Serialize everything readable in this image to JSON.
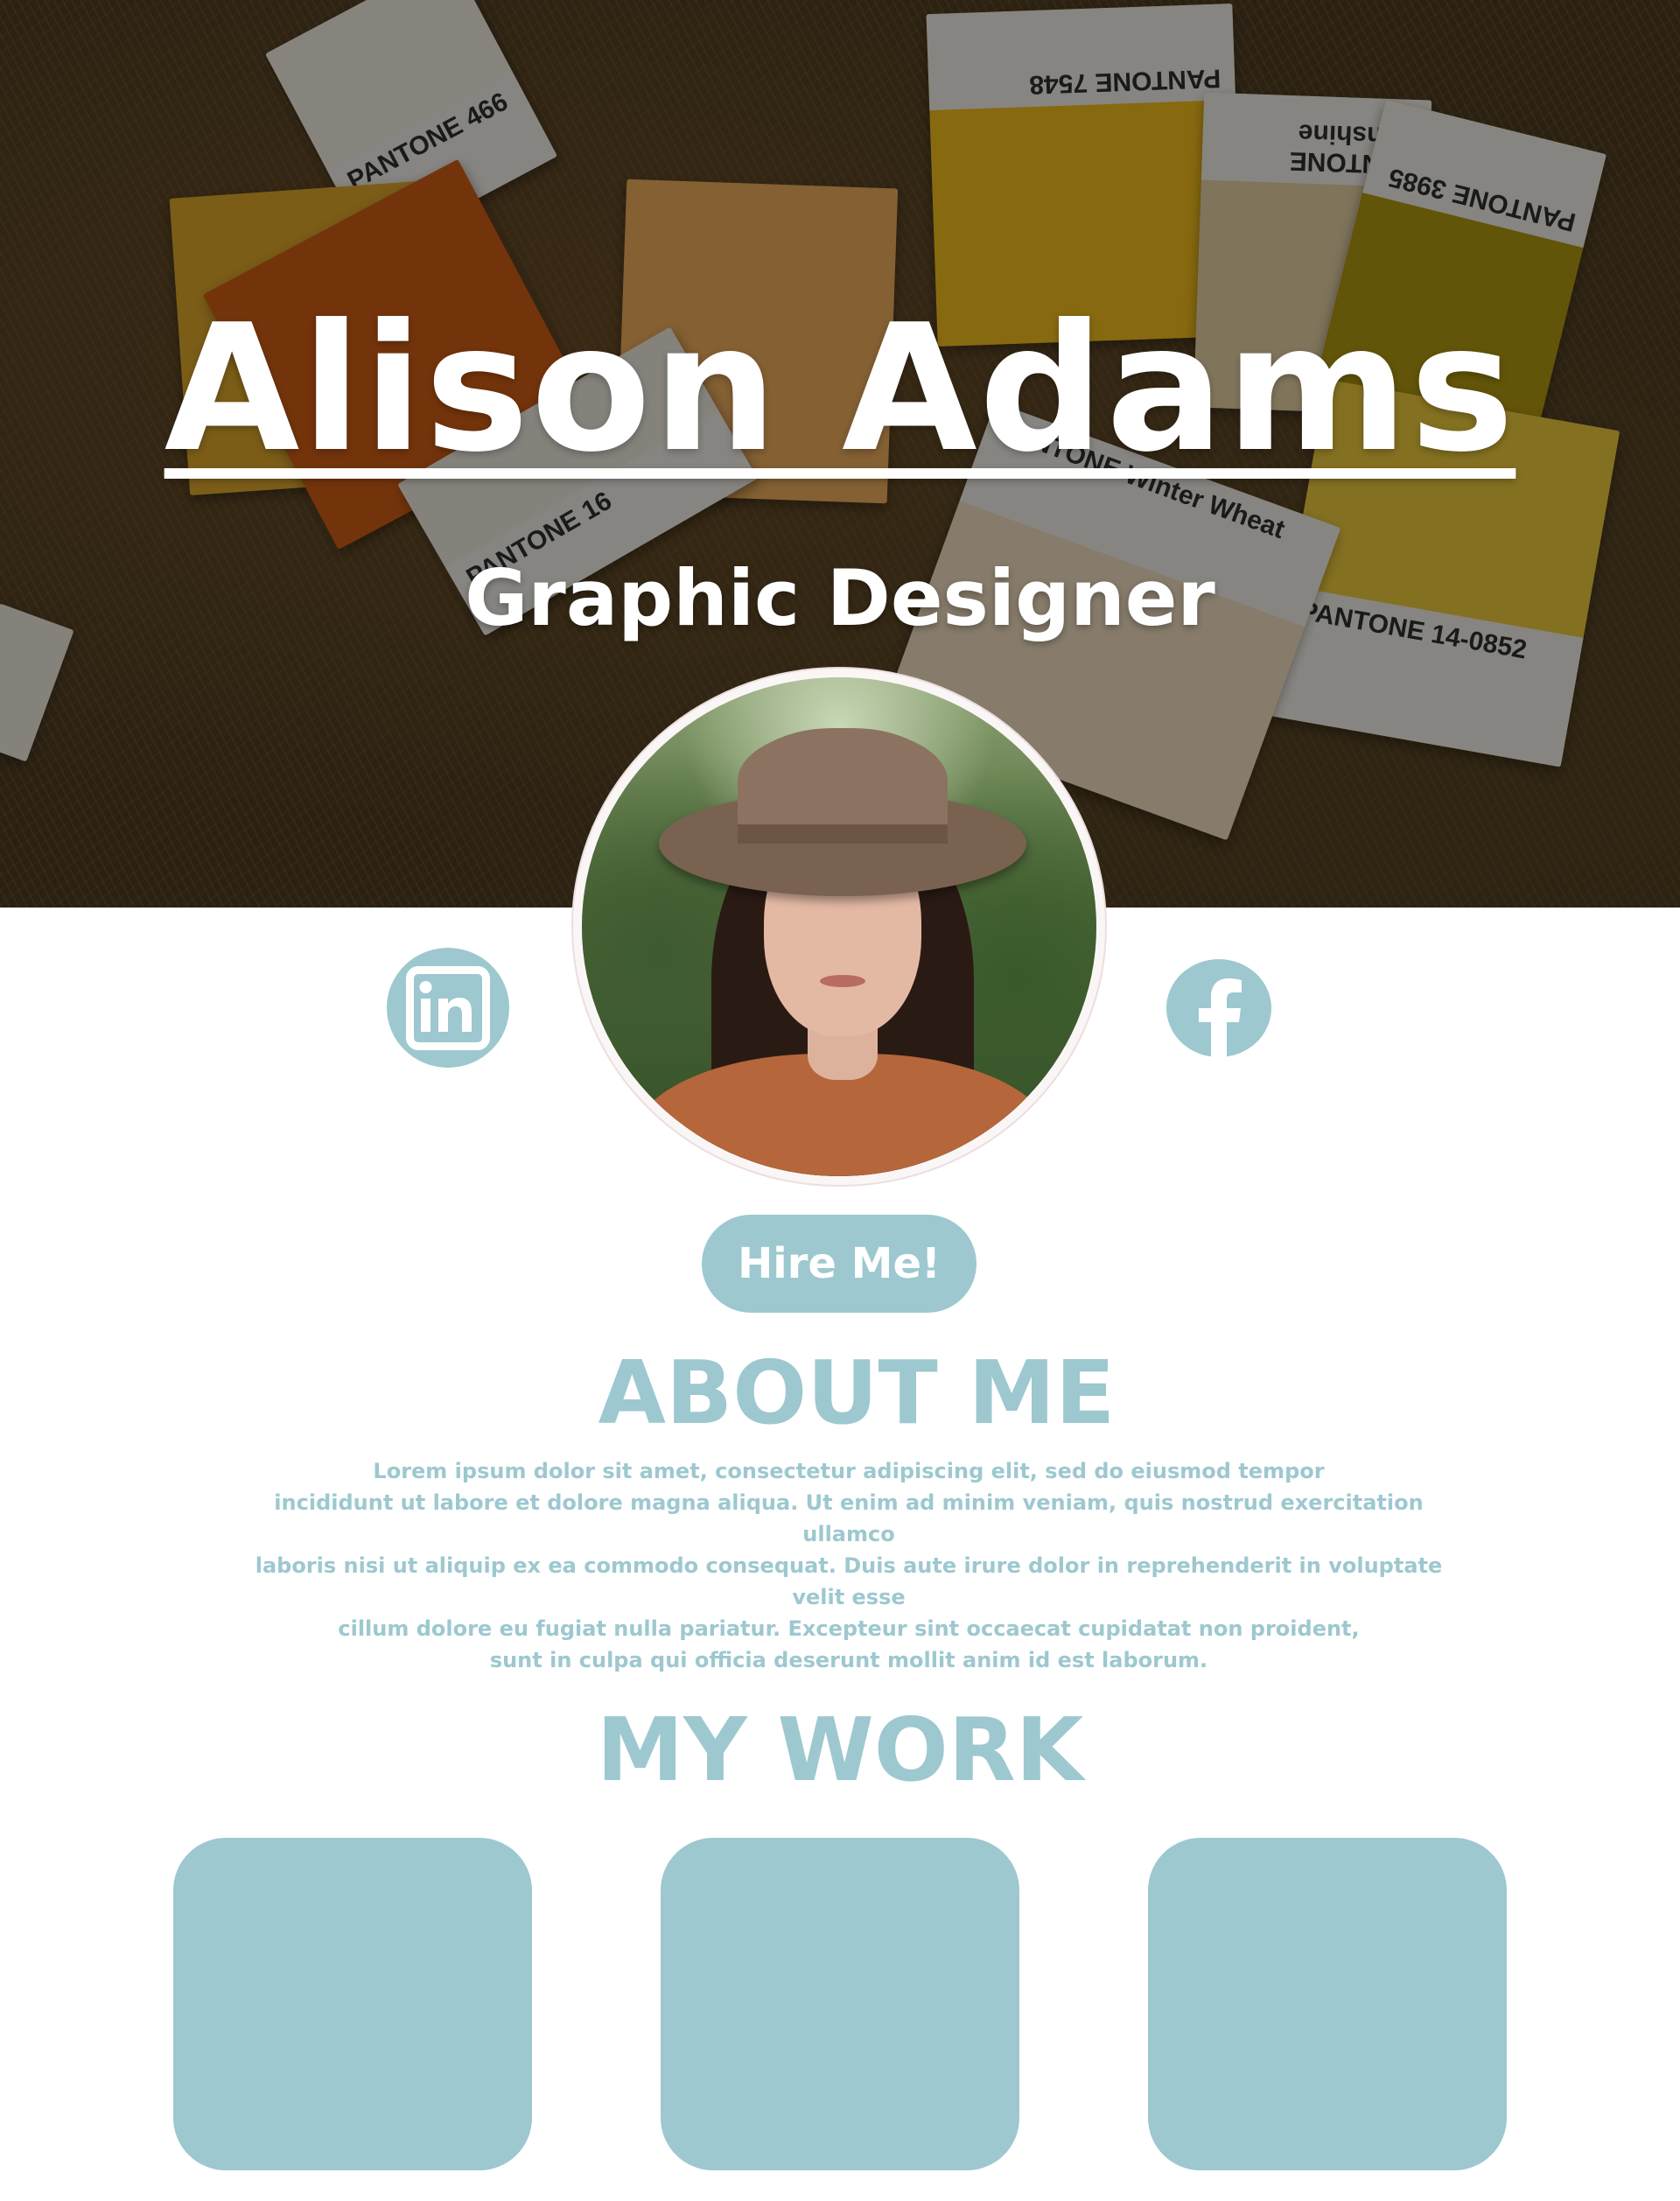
{
  "hero": {
    "name": "Alison Adams",
    "role": "Graphic Designer",
    "background_cards": [
      {
        "label": "PANTONE 466"
      },
      {
        "label": "PANTONE 7548"
      },
      {
        "label": "PANTONE Sunshine"
      },
      {
        "label": "PANTONE 3985"
      },
      {
        "label": "PANTONE 16"
      },
      {
        "label": "PANTONE Winter Wheat"
      },
      {
        "label": "PANTONE 14-0852"
      }
    ]
  },
  "avatar": {
    "alt": "Portrait of Alison Adams"
  },
  "social": {
    "linkedin_icon": "linkedin-icon",
    "facebook_icon": "facebook-icon"
  },
  "cta": {
    "hire_label": "Hire Me!"
  },
  "about": {
    "title": "ABOUT ME",
    "lines": [
      "Lorem ipsum dolor sit amet, consectetur adipiscing elit, sed do eiusmod tempor",
      "incididunt ut labore et dolore magna aliqua.   Ut enim ad minim veniam, quis nostrud exercitation ullamco",
      "laboris nisi ut aliquip ex ea commodo consequat.  Duis aute irure dolor in reprehenderit in voluptate velit esse",
      "cillum dolore eu fugiat nulla pariatur. Excepteur sint occaecat cupidatat non proident,",
      "sunt in culpa qui officia deserunt mollit anim id est laborum."
    ]
  },
  "work": {
    "title": "MY WORK",
    "tiles": 3
  },
  "colors": {
    "accent": "#9dc8cf",
    "hero_text": "#ffffff",
    "page_bg": "#ffffff"
  }
}
